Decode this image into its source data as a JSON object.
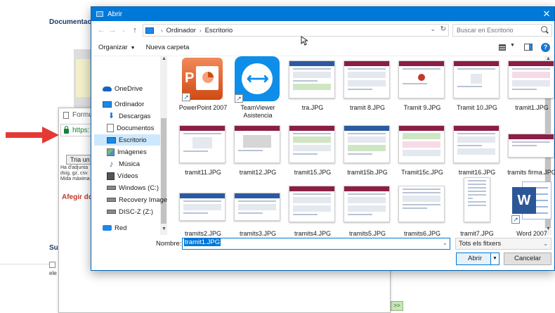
{
  "background": {
    "title": "Documentaci",
    "subtitle": "Sul",
    "footnote": "ele",
    "next_label": ">>"
  },
  "popup": {
    "tab_title": "Formu",
    "url": "https:",
    "browse_label": "Tria un",
    "note_lines": [
      "Ha d'adjunta",
      "dsig, gz, csv",
      "Mida màxima"
    ],
    "add_title": "Afegir doc"
  },
  "dialog": {
    "title": "Abrir",
    "close": "✕",
    "breadcrumb": [
      "Ordinador",
      "Escritorio"
    ],
    "search_placeholder": "Buscar en Escritorio",
    "toolbar": {
      "organize": "Organizar",
      "new_folder": "Nueva carpeta",
      "help": "?"
    },
    "sidebar": [
      {
        "label": "OneDrive",
        "icon": "cloud-icon"
      },
      {
        "label": "Ordinador",
        "icon": "computer-icon"
      },
      {
        "label": "Descargas",
        "icon": "download-icon"
      },
      {
        "label": "Documentos",
        "icon": "documents-icon"
      },
      {
        "label": "Escritorio",
        "icon": "desktop-icon",
        "selected": true
      },
      {
        "label": "Imágenes",
        "icon": "pictures-icon"
      },
      {
        "label": "Música",
        "icon": "music-icon"
      },
      {
        "label": "Vídeos",
        "icon": "videos-icon"
      },
      {
        "label": "Windows (C:)",
        "icon": "drive-icon"
      },
      {
        "label": "Recovery Image",
        "icon": "drive-icon"
      },
      {
        "label": "DISC-Z (Z:)",
        "icon": "drive-icon"
      },
      {
        "label": "Red",
        "icon": "network-icon"
      }
    ],
    "files": [
      {
        "name": "PowerPoint 2007",
        "icon": "powerpoint-icon"
      },
      {
        "name": "TeamViewer Asistencia",
        "icon": "teamviewer-icon"
      },
      {
        "name": "tra.JPG",
        "icon": "image-thumbnail"
      },
      {
        "name": "tramit 8.JPG",
        "icon": "image-thumbnail"
      },
      {
        "name": "Tramit 9.JPG",
        "icon": "image-thumbnail"
      },
      {
        "name": "Tramit 10.JPG",
        "icon": "image-thumbnail"
      },
      {
        "name": "tramit1.JPG",
        "icon": "image-thumbnail"
      },
      {
        "name": "tramit11.JPG",
        "icon": "image-thumbnail"
      },
      {
        "name": "tramit12.JPG",
        "icon": "image-thumbnail"
      },
      {
        "name": "tramit15.JPG",
        "icon": "image-thumbnail"
      },
      {
        "name": "tramit15b.JPG",
        "icon": "image-thumbnail"
      },
      {
        "name": "Tramit15c.JPG",
        "icon": "image-thumbnail"
      },
      {
        "name": "tramit16.JPG",
        "icon": "image-thumbnail"
      },
      {
        "name": "tramits firma.JPG",
        "icon": "image-thumbnail"
      },
      {
        "name": "tramits2.JPG",
        "icon": "image-thumbnail"
      },
      {
        "name": "tramits3.JPG",
        "icon": "image-thumbnail"
      },
      {
        "name": "tramits4.JPG",
        "icon": "image-thumbnail"
      },
      {
        "name": "tramits5.JPG",
        "icon": "image-thumbnail"
      },
      {
        "name": "tramits6.JPG",
        "icon": "image-thumbnail"
      },
      {
        "name": "tramit7.JPG",
        "icon": "image-thumbnail"
      },
      {
        "name": "Word 2007",
        "icon": "word-icon"
      }
    ],
    "name_label": "Nombre:",
    "name_value": "tramit1.JPG",
    "filter_value": "Tots els fitxers",
    "open_label": "Abrir",
    "cancel_label": "Cancelar"
  },
  "colors": {
    "accent": "#0078d7",
    "selection": "#cce8ff",
    "https_green": "#188038",
    "arrow_red": "#e53935"
  }
}
